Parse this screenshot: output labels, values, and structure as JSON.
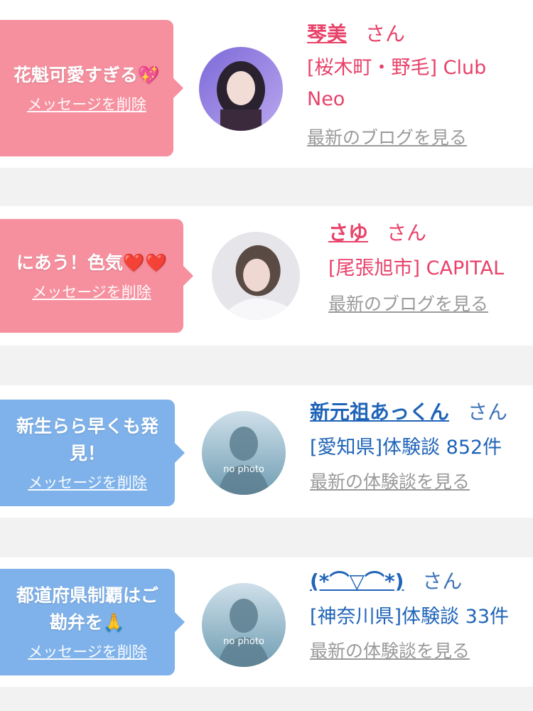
{
  "cards": [
    {
      "message": "花魁可愛すぎる💖",
      "delete_label": "メッセージを削除",
      "name": "琴美",
      "honorific": "さん",
      "location_text": "[桜木町・野毛] Club Neo",
      "latest_link": "最新のブログを見る",
      "theme": "pink"
    },
    {
      "message": "にあう！色気❤️❤️",
      "delete_label": "メッセージを削除",
      "name": "さゆ",
      "honorific": "さん",
      "location_text": "[尾張旭市] CAPITAL",
      "latest_link": "最新のブログを見る",
      "theme": "pink"
    },
    {
      "message": "新生らら早くも発見！",
      "delete_label": "メッセージを削除",
      "name": "新元祖あっくん",
      "honorific": "さん",
      "location_text": "[愛知県]体験談 852件",
      "latest_link": "最新の体験談を見る",
      "theme": "blue",
      "avatar_caption": "no photo"
    },
    {
      "message": "都道府県制覇はご勘弁を🙏",
      "delete_label": "メッセージを削除",
      "name": "(*⌒▽⌒*)",
      "honorific": "さん",
      "location_text": "[神奈川県]体験談 33件",
      "latest_link": "最新の体験談を見る",
      "theme": "blue",
      "avatar_caption": "no photo"
    }
  ],
  "colors": {
    "pink_bubble": "#f6909f",
    "blue_bubble": "#7fb2ea",
    "pink_text": "#e8426a",
    "blue_text": "#1f64b8",
    "link_gray": "#9a9a9a"
  }
}
